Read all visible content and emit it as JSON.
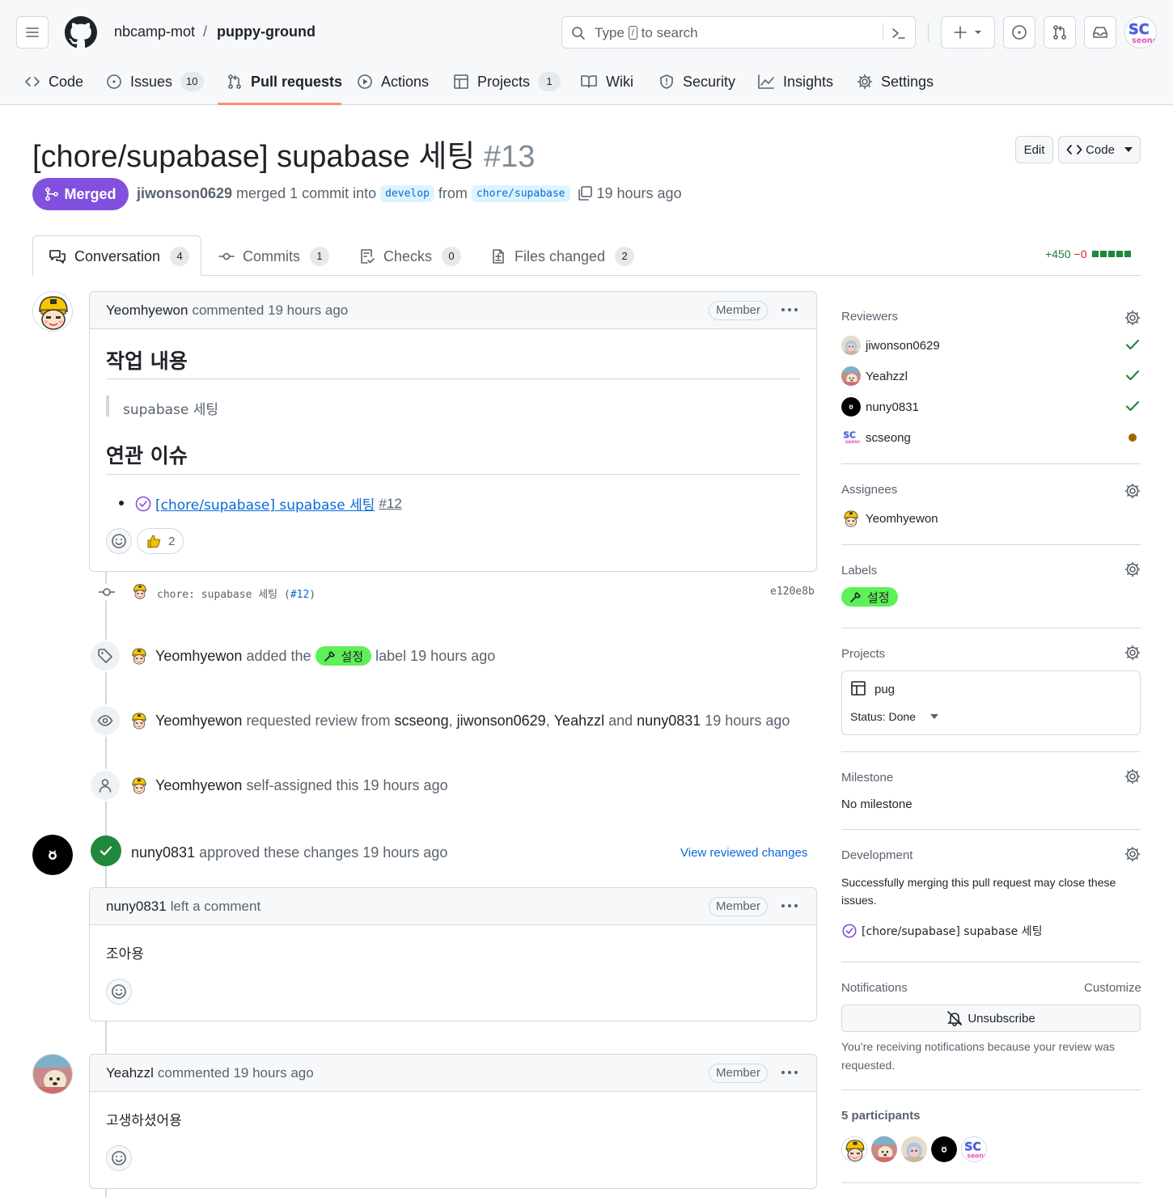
{
  "header": {
    "owner": "nbcamp-mot",
    "repo": "puppy-ground",
    "search_before": "Type",
    "search_key": "/",
    "search_after": "to search"
  },
  "repo_tabs": [
    {
      "label": "Code",
      "count": ""
    },
    {
      "label": "Issues",
      "count": "10"
    },
    {
      "label": "Pull requests",
      "count": ""
    },
    {
      "label": "Actions",
      "count": ""
    },
    {
      "label": "Projects",
      "count": "1"
    },
    {
      "label": "Wiki",
      "count": ""
    },
    {
      "label": "Security",
      "count": ""
    },
    {
      "label": "Insights",
      "count": ""
    },
    {
      "label": "Settings",
      "count": ""
    }
  ],
  "pr": {
    "title": "[chore/supabase] supabase 세팅",
    "number": "#13",
    "edit_label": "Edit",
    "code_label": "Code",
    "state": "Merged",
    "author": "jiwonson0629",
    "merged_text": "merged 1 commit into",
    "base": "develop",
    "from_text": "from",
    "head": "chore/supabase",
    "time": "19 hours ago"
  },
  "pr_tabs": [
    {
      "label": "Conversation",
      "count": "4"
    },
    {
      "label": "Commits",
      "count": "1"
    },
    {
      "label": "Checks",
      "count": "0"
    },
    {
      "label": "Files changed",
      "count": "2"
    }
  ],
  "diffstat": {
    "added": "+450",
    "removed": "−0"
  },
  "comment1": {
    "author": "Yeomhyewon",
    "meta": "commented 19 hours ago",
    "role": "Member",
    "h1": "작업 내용",
    "quote": "supabase 세팅",
    "h2": "연관 이슈",
    "issue_link": "[chore/supabase] supabase 세팅",
    "issue_num": "#12",
    "thumbs": "2"
  },
  "commit": {
    "message": "chore: supabase 세팅 (",
    "ref": "#12",
    "close": ")",
    "sha": "e120e8b"
  },
  "events": {
    "label_actor": "Yeomhyewon",
    "label_pre": "added the",
    "label_name": "설정",
    "label_post": "label 19 hours ago",
    "review_actor": "Yeomhyewon",
    "review_pre": "requested review from",
    "r1": "scseong",
    "r2": "jiwonson0629",
    "r3": "Yeahzzl",
    "and": "and",
    "r4": "nuny0831",
    "review_time": "19 hours ago",
    "assign_actor": "Yeomhyewon",
    "assign_text": "self-assigned this 19 hours ago"
  },
  "approval": {
    "actor": "nuny0831",
    "text": "approved these changes 19 hours ago",
    "link": "View reviewed changes"
  },
  "comment2": {
    "author": "nuny0831",
    "meta": "left a comment",
    "role": "Member",
    "body": "조아용"
  },
  "comment3": {
    "author": "Yeahzzl",
    "meta": "commented 19 hours ago",
    "role": "Member",
    "body": "고생하셨어용"
  },
  "sidebar": {
    "reviewers_title": "Reviewers",
    "reviewers": [
      {
        "name": "jiwonson0629",
        "status": "approved"
      },
      {
        "name": "Yeahzzl",
        "status": "approved"
      },
      {
        "name": "nuny0831",
        "status": "approved"
      },
      {
        "name": "scseong",
        "status": "pending"
      }
    ],
    "assignees_title": "Assignees",
    "assignee": "Yeomhyewon",
    "labels_title": "Labels",
    "label": "설정",
    "projects_title": "Projects",
    "project": "pug",
    "project_status": "Status: Done",
    "milestone_title": "Milestone",
    "milestone": "No milestone",
    "development_title": "Development",
    "development_text": "Successfully merging this pull request may close these issues.",
    "development_issue": "[chore/supabase] supabase 세팅",
    "notifications_title": "Notifications",
    "customize": "Customize",
    "unsubscribe": "Unsubscribe",
    "notif_reason": "You’re receiving notifications because your review was requested.",
    "participants": "5 participants"
  },
  "colors": {
    "merged": "#8250df",
    "label": "#5ef057",
    "link": "#0969da",
    "success": "#1f883d",
    "pending": "#9a6700"
  }
}
